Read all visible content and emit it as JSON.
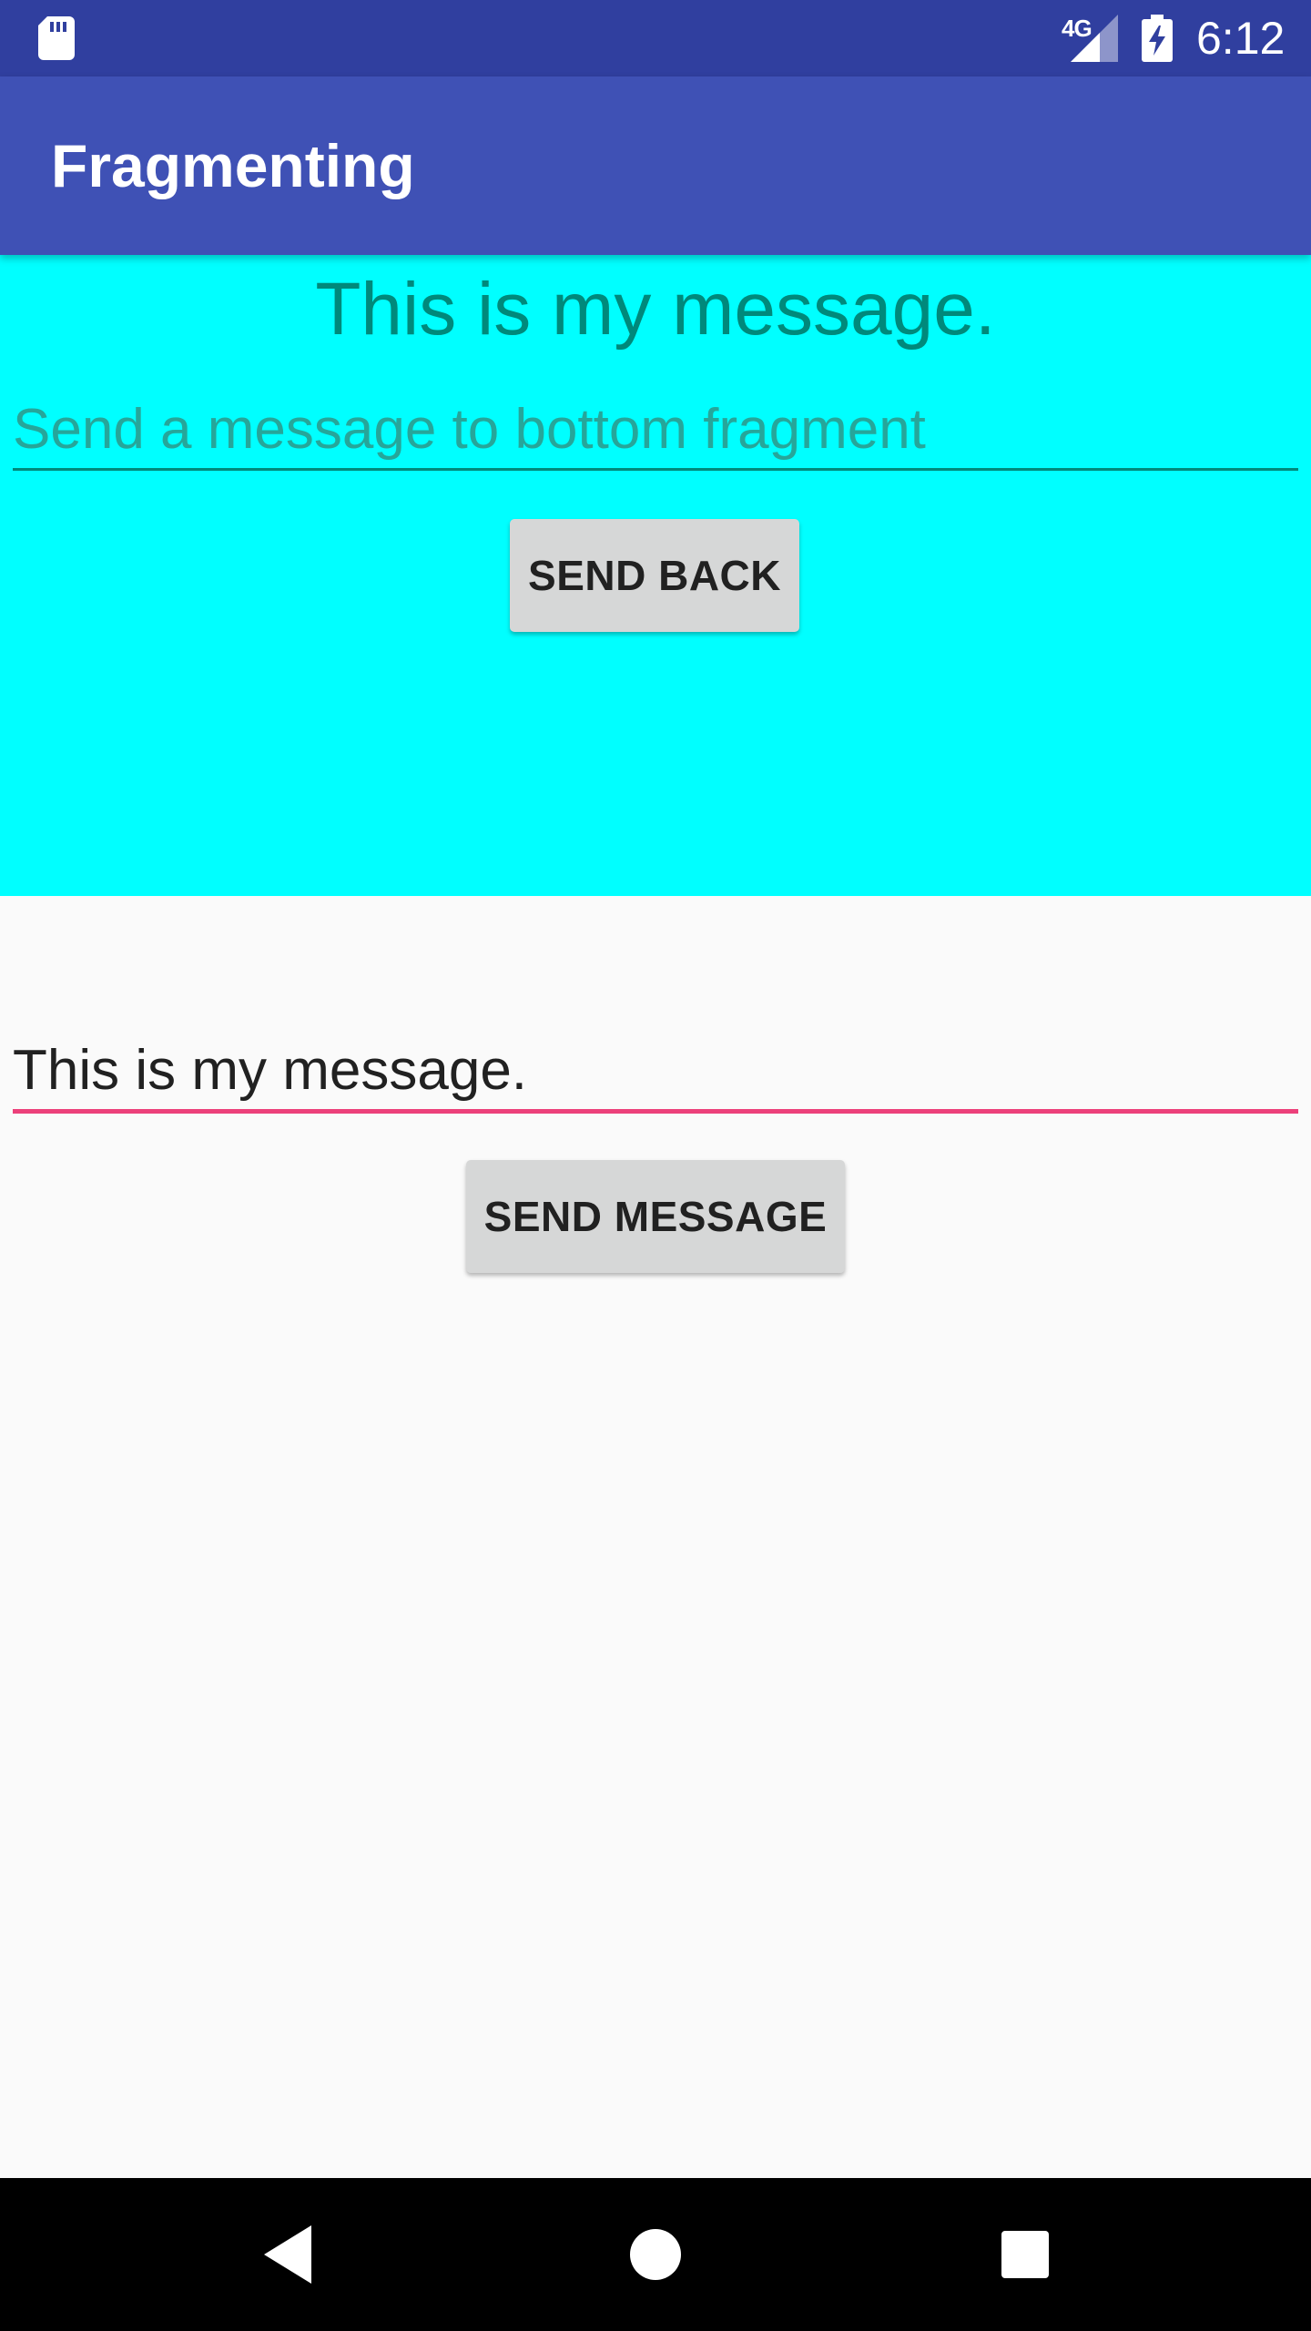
{
  "status_bar": {
    "time": "6:12",
    "network": "4G",
    "icons": [
      "sd-card-icon",
      "signal-icon",
      "battery-charging-icon"
    ]
  },
  "app_bar": {
    "title": "Fragmenting"
  },
  "top_fragment": {
    "message": "This is my message.",
    "input": {
      "value": "",
      "placeholder": "Send a message to bottom fragment"
    },
    "button_label": "SEND BACK",
    "background": "#00ffff",
    "text_color": "#00897b"
  },
  "bottom_fragment": {
    "input": {
      "value": "This is my message.",
      "placeholder": ""
    },
    "button_label": "SEND MESSAGE",
    "accent": "#ec407a"
  },
  "nav_bar": {
    "buttons": [
      "back-icon",
      "home-icon",
      "recents-icon"
    ]
  },
  "colors": {
    "primary": "#3f51b5",
    "primary_dark": "#303f9f",
    "background": "#fafafa"
  }
}
